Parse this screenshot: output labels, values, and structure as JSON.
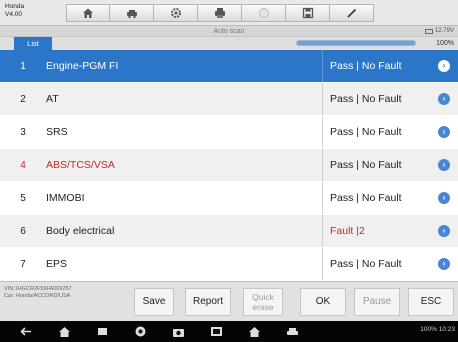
{
  "app": {
    "brand": "Honda",
    "version": "V4.00"
  },
  "toolbar": {
    "icons": [
      "home-icon",
      "vehicle-swap-icon",
      "settings-icon",
      "print-icon",
      "help-icon",
      "save-icon",
      "edit-icon"
    ]
  },
  "title": "Auto scan",
  "battery": "12.79V",
  "tab_label": "List",
  "progress": {
    "value": 100,
    "label": "100%"
  },
  "systems": [
    {
      "num": "1",
      "name": "Engine-PGM FI",
      "result": "Pass | No Fault",
      "selected": true,
      "fault": false,
      "highlight_name": false
    },
    {
      "num": "2",
      "name": "AT",
      "result": "Pass | No Fault",
      "selected": false,
      "fault": false,
      "highlight_name": false
    },
    {
      "num": "3",
      "name": "SRS",
      "result": "Pass | No Fault",
      "selected": false,
      "fault": false,
      "highlight_name": false
    },
    {
      "num": "4",
      "name": "ABS/TCS/VSA",
      "result": "Pass | No Fault",
      "selected": false,
      "fault": false,
      "highlight_name": true
    },
    {
      "num": "5",
      "name": "IMMOBI",
      "result": "Pass | No Fault",
      "selected": false,
      "fault": false,
      "highlight_name": false
    },
    {
      "num": "6",
      "name": "Body electrical",
      "result": "Fault |2",
      "selected": false,
      "fault": true,
      "highlight_name": false
    },
    {
      "num": "7",
      "name": "EPS",
      "result": "Pass | No Fault",
      "selected": false,
      "fault": false,
      "highlight_name": false
    }
  ],
  "vehicle_info": {
    "vin": "VIN:1HGCR2F59FA069257",
    "car": "Car: Honda/ACCORD/USA"
  },
  "buttons": {
    "save": "Save",
    "report": "Report",
    "quick_erase": "Quick erase",
    "ok": "OK",
    "pause": "Pause",
    "esc": "ESC"
  },
  "status_bar": {
    "time": "100% 10:23"
  },
  "colors": {
    "accent": "#2b76c8",
    "fault": "#c62828"
  }
}
